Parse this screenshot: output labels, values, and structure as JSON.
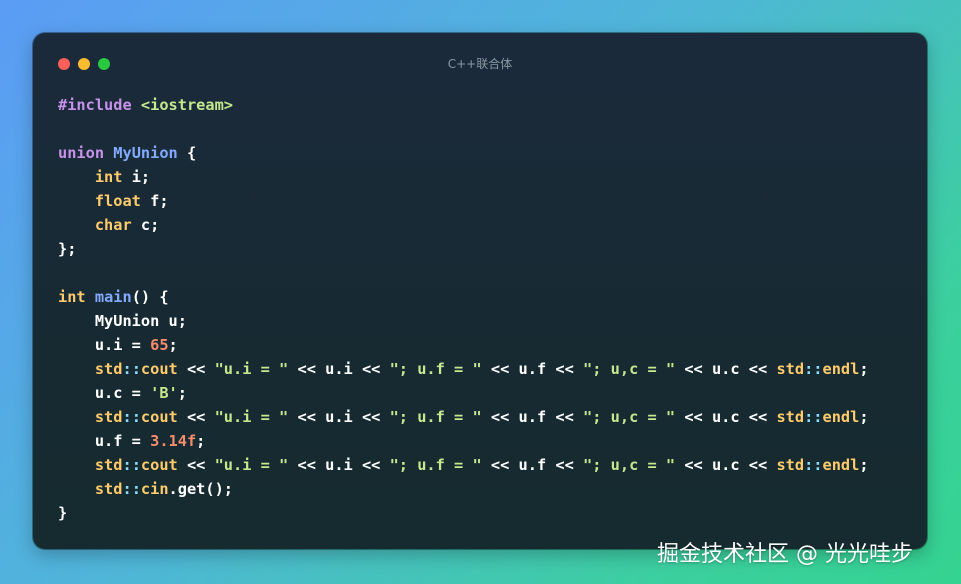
{
  "window": {
    "title": "C++联合体",
    "traffic_lights": {
      "close_color": "#ff5f57",
      "minimize_color": "#febc2e",
      "zoom_color": "#28c840"
    }
  },
  "code": {
    "language": "cpp",
    "lines": [
      [
        {
          "t": "#",
          "c": "pre"
        },
        {
          "t": "include",
          "c": "pre"
        },
        {
          "t": " ",
          "c": "id"
        },
        {
          "t": "<iostream>",
          "c": "inc"
        }
      ],
      [],
      [
        {
          "t": "union",
          "c": "kw"
        },
        {
          "t": " ",
          "c": "id"
        },
        {
          "t": "MyUnion",
          "c": "cls"
        },
        {
          "t": " {",
          "c": "punc"
        }
      ],
      [
        {
          "t": "    ",
          "c": "id"
        },
        {
          "t": "int",
          "c": "type"
        },
        {
          "t": " i;",
          "c": "id"
        }
      ],
      [
        {
          "t": "    ",
          "c": "id"
        },
        {
          "t": "float",
          "c": "type"
        },
        {
          "t": " f;",
          "c": "id"
        }
      ],
      [
        {
          "t": "    ",
          "c": "id"
        },
        {
          "t": "char",
          "c": "type"
        },
        {
          "t": " c;",
          "c": "id"
        }
      ],
      [
        {
          "t": "};",
          "c": "punc"
        }
      ],
      [],
      [
        {
          "t": "int",
          "c": "type"
        },
        {
          "t": " ",
          "c": "id"
        },
        {
          "t": "main",
          "c": "fn"
        },
        {
          "t": "() {",
          "c": "punc"
        }
      ],
      [
        {
          "t": "    MyUnion u;",
          "c": "id"
        }
      ],
      [
        {
          "t": "    u.i = ",
          "c": "id"
        },
        {
          "t": "65",
          "c": "num"
        },
        {
          "t": ";",
          "c": "punc"
        }
      ],
      [
        {
          "t": "    ",
          "c": "id"
        },
        {
          "t": "std",
          "c": "ns"
        },
        {
          "t": "::",
          "c": "op"
        },
        {
          "t": "cout",
          "c": "ns"
        },
        {
          "t": " << ",
          "c": "id"
        },
        {
          "t": "\"u.i = \"",
          "c": "str"
        },
        {
          "t": " << u.i << ",
          "c": "id"
        },
        {
          "t": "\"; u.f = \"",
          "c": "str"
        },
        {
          "t": " << u.f << ",
          "c": "id"
        },
        {
          "t": "\"; u,c = \"",
          "c": "str"
        },
        {
          "t": " << u.c << ",
          "c": "id"
        },
        {
          "t": "std",
          "c": "ns"
        },
        {
          "t": "::",
          "c": "op"
        },
        {
          "t": "endl",
          "c": "ns"
        },
        {
          "t": ";",
          "c": "punc"
        }
      ],
      [
        {
          "t": "    u.c = ",
          "c": "id"
        },
        {
          "t": "'B'",
          "c": "str"
        },
        {
          "t": ";",
          "c": "punc"
        }
      ],
      [
        {
          "t": "    ",
          "c": "id"
        },
        {
          "t": "std",
          "c": "ns"
        },
        {
          "t": "::",
          "c": "op"
        },
        {
          "t": "cout",
          "c": "ns"
        },
        {
          "t": " << ",
          "c": "id"
        },
        {
          "t": "\"u.i = \"",
          "c": "str"
        },
        {
          "t": " << u.i << ",
          "c": "id"
        },
        {
          "t": "\"; u.f = \"",
          "c": "str"
        },
        {
          "t": " << u.f << ",
          "c": "id"
        },
        {
          "t": "\"; u,c = \"",
          "c": "str"
        },
        {
          "t": " << u.c << ",
          "c": "id"
        },
        {
          "t": "std",
          "c": "ns"
        },
        {
          "t": "::",
          "c": "op"
        },
        {
          "t": "endl",
          "c": "ns"
        },
        {
          "t": ";",
          "c": "punc"
        }
      ],
      [
        {
          "t": "    u.f = ",
          "c": "id"
        },
        {
          "t": "3.14f",
          "c": "num"
        },
        {
          "t": ";",
          "c": "punc"
        }
      ],
      [
        {
          "t": "    ",
          "c": "id"
        },
        {
          "t": "std",
          "c": "ns"
        },
        {
          "t": "::",
          "c": "op"
        },
        {
          "t": "cout",
          "c": "ns"
        },
        {
          "t": " << ",
          "c": "id"
        },
        {
          "t": "\"u.i = \"",
          "c": "str"
        },
        {
          "t": " << u.i << ",
          "c": "id"
        },
        {
          "t": "\"; u.f = \"",
          "c": "str"
        },
        {
          "t": " << u.f << ",
          "c": "id"
        },
        {
          "t": "\"; u,c = \"",
          "c": "str"
        },
        {
          "t": " << u.c << ",
          "c": "id"
        },
        {
          "t": "std",
          "c": "ns"
        },
        {
          "t": "::",
          "c": "op"
        },
        {
          "t": "endl",
          "c": "ns"
        },
        {
          "t": ";",
          "c": "punc"
        }
      ],
      [
        {
          "t": "    ",
          "c": "id"
        },
        {
          "t": "std",
          "c": "ns"
        },
        {
          "t": "::",
          "c": "op"
        },
        {
          "t": "cin",
          "c": "ns"
        },
        {
          "t": ".get();",
          "c": "id"
        }
      ],
      [
        {
          "t": "}",
          "c": "punc"
        }
      ]
    ]
  },
  "watermark": {
    "text": "掘金技术社区 @ 光光哇步"
  }
}
